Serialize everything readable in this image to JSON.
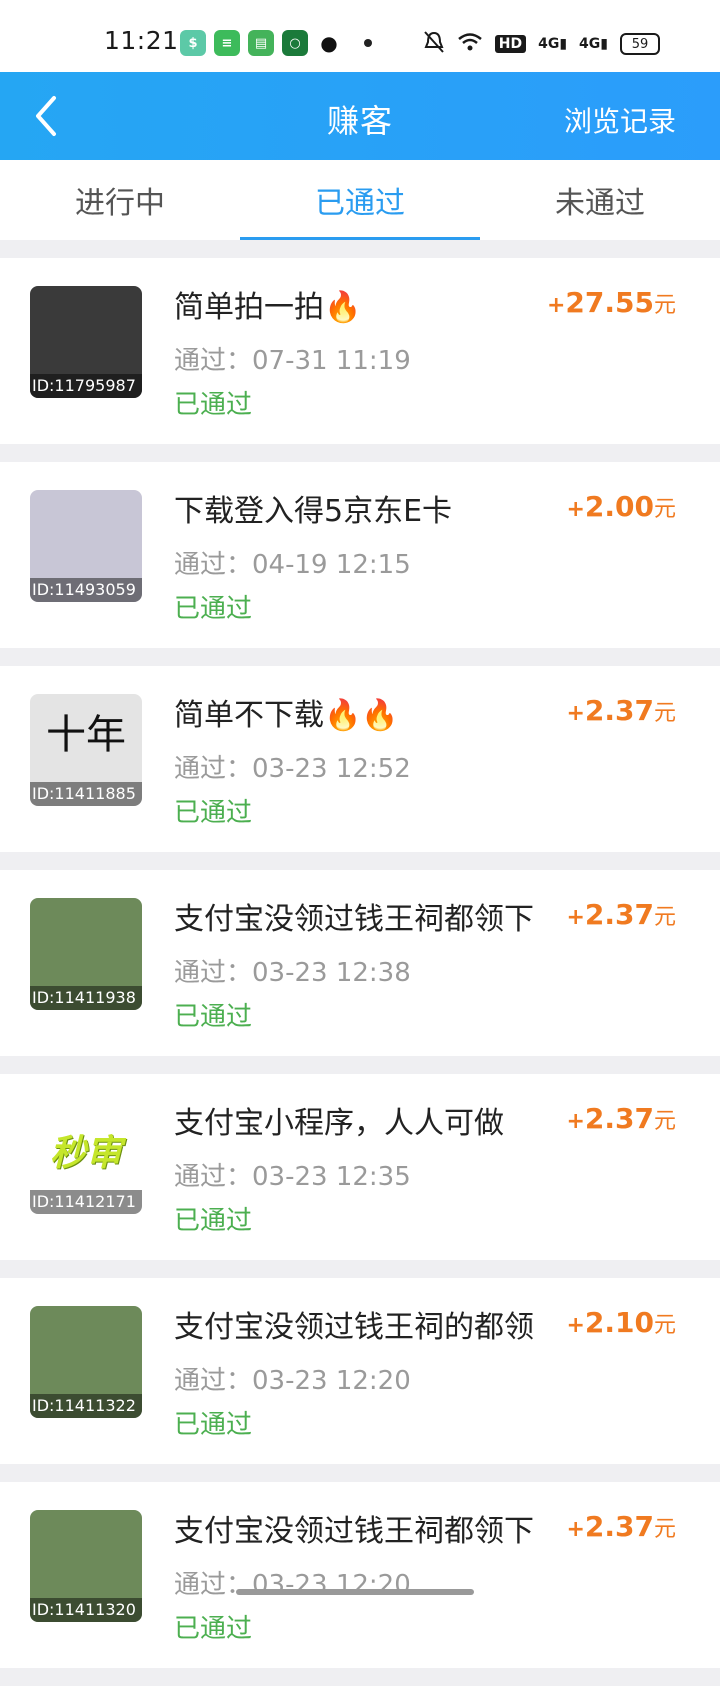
{
  "status_bar": {
    "time": "11:21",
    "battery": "59",
    "network": [
      "HD",
      "4G",
      "4G"
    ]
  },
  "header": {
    "title": "赚客",
    "right_action": "浏览记录"
  },
  "tabs": [
    {
      "label": "进行中",
      "active": false
    },
    {
      "label": "已通过",
      "active": true
    },
    {
      "label": "未通过",
      "active": false
    }
  ],
  "items": [
    {
      "id_label": "ID:11795987",
      "title": "简单拍一拍🔥",
      "date": "通过：07-31 11:19",
      "status": "已通过",
      "plus": "+",
      "amount": "27.55",
      "unit": "元",
      "thumb_color": "#3a3a3a"
    },
    {
      "id_label": "ID:11493059",
      "title": "下载登入得5京东E卡",
      "date": "通过：04-19 12:15",
      "status": "已通过",
      "plus": "+",
      "amount": "2.00",
      "unit": "元",
      "thumb_color": "#c8c6d6"
    },
    {
      "id_label": "ID:11411885",
      "title": "简单不下载🔥🔥",
      "date": "通过：03-23 12:52",
      "status": "已通过",
      "plus": "+",
      "amount": "2.37",
      "unit": "元",
      "thumb_color": "#e4e4e4",
      "thumb_glyph": "十年"
    },
    {
      "id_label": "ID:11411938",
      "title": "支付宝没领过钱王祠都领下",
      "date": "通过：03-23 12:38",
      "status": "已通过",
      "plus": "+",
      "amount": "2.37",
      "unit": "元",
      "thumb_color": "#6d8a5a"
    },
    {
      "id_label": "ID:11412171",
      "title": "支付宝小程序，人人可做",
      "date": "通过：03-23 12:35",
      "status": "已通过",
      "plus": "+",
      "amount": "2.37",
      "unit": "元",
      "thumb_color": "#ffffff",
      "thumb_glyph": "秒审"
    },
    {
      "id_label": "ID:11411322",
      "title": "支付宝没领过钱王祠的都领",
      "date": "通过：03-23 12:20",
      "status": "已通过",
      "plus": "+",
      "amount": "2.10",
      "unit": "元",
      "thumb_color": "#6d8a5a"
    },
    {
      "id_label": "ID:11411320",
      "title": "支付宝没领过钱王祠都领下",
      "date": "通过：03-23 12:20",
      "status": "已通过",
      "plus": "+",
      "amount": "2.37",
      "unit": "元",
      "thumb_color": "#6d8a5a"
    }
  ]
}
